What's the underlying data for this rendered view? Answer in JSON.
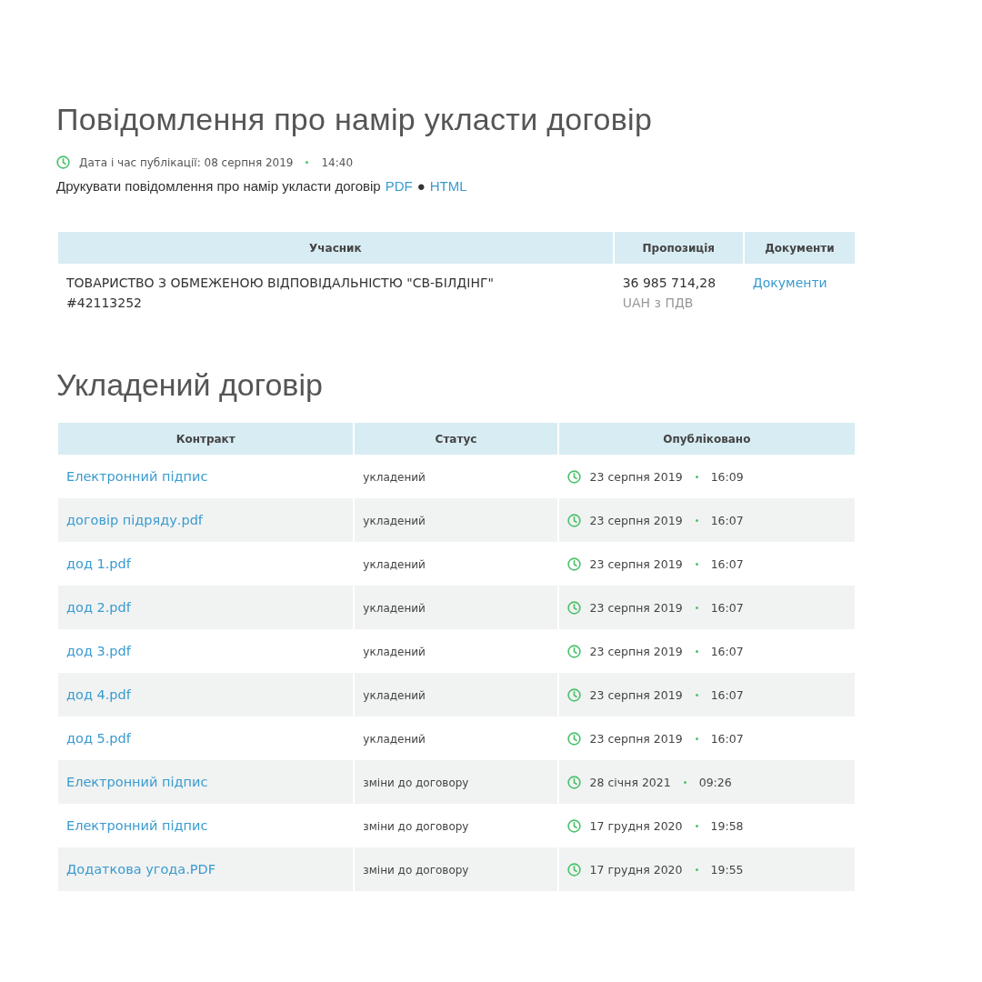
{
  "notice": {
    "title": "Повідомлення про намір укласти договір",
    "published_label": "Дата і час публікації: 08 серпня 2019",
    "published_time": "14:40",
    "print_text": "Друкувати повідомлення про намір укласти договір",
    "print_links": [
      "PDF",
      "HTML"
    ],
    "print_separator": "●"
  },
  "participants": {
    "columns": [
      "Учасник",
      "Пропозиція",
      "Документи"
    ],
    "rows": [
      {
        "name": "ТОВАРИСТВО З ОБМЕЖЕНОЮ ВІДПОВІДАЛЬНІСТЮ \"СВ-БІЛДІНГ\"",
        "code": "#42113252",
        "amount": "36 985 714,28",
        "currency": "UAH з ПДВ",
        "documents": "Документи"
      }
    ]
  },
  "contract": {
    "title": "Укладений договір",
    "columns": [
      "Контракт",
      "Статус",
      "Опубліковано"
    ],
    "rows": [
      {
        "name": "Електронний підпис",
        "status": "укладений",
        "date": "23 серпня 2019",
        "time": "16:09"
      },
      {
        "name": "договір підряду.pdf",
        "status": "укладений",
        "date": "23 серпня 2019",
        "time": "16:07"
      },
      {
        "name": "дод 1.pdf",
        "status": "укладений",
        "date": "23 серпня 2019",
        "time": "16:07"
      },
      {
        "name": "дод 2.pdf",
        "status": "укладений",
        "date": "23 серпня 2019",
        "time": "16:07"
      },
      {
        "name": "дод 3.pdf",
        "status": "укладений",
        "date": "23 серпня 2019",
        "time": "16:07"
      },
      {
        "name": "дод 4.pdf",
        "status": "укладений",
        "date": "23 серпня 2019",
        "time": "16:07"
      },
      {
        "name": "дод 5.pdf",
        "status": "укладений",
        "date": "23 серпня 2019",
        "time": "16:07"
      },
      {
        "name": "Електронний підпис",
        "status": "зміни до договору",
        "date": "28 січня 2021",
        "time": "09:26"
      },
      {
        "name": "Електронний підпис",
        "status": "зміни до договору",
        "date": "17 грудня 2020",
        "time": "19:58"
      },
      {
        "name": "Додаткова угода.PDF",
        "status": "зміни до договору",
        "date": "17 грудня 2020",
        "time": "19:55"
      }
    ]
  }
}
